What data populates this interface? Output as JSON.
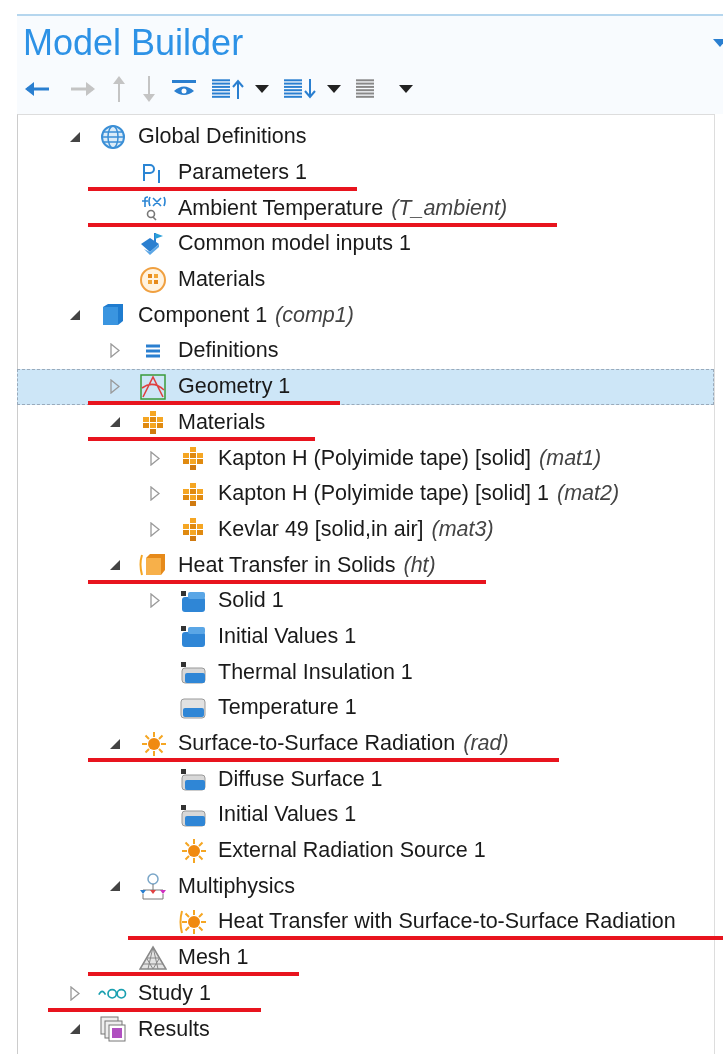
{
  "title": "Model Builder",
  "toolbar": [
    {
      "kind": "back",
      "disabled": false
    },
    {
      "kind": "forward",
      "disabled": true
    },
    {
      "kind": "up",
      "disabled": true
    },
    {
      "kind": "down",
      "disabled": true
    },
    {
      "kind": "eye",
      "disabled": false
    },
    {
      "kind": "list-up",
      "disabled": false
    },
    {
      "kind": "list-down",
      "disabled": false
    },
    {
      "kind": "list",
      "disabled": false
    }
  ],
  "tree": [
    {
      "label": "Global Definitions",
      "kind": "globe",
      "expanded": true,
      "selected": false,
      "marked": false,
      "children": [
        {
          "label": "Parameters 1",
          "kind": "param",
          "selected": false,
          "marked": true
        },
        {
          "label": "Ambient Temperature",
          "tag": "(T_ambient)",
          "kind": "function",
          "selected": false,
          "marked": true
        },
        {
          "label": "Common model inputs 1",
          "kind": "inputs",
          "selected": false,
          "marked": false
        },
        {
          "label": "Materials",
          "kind": "materials-global",
          "selected": false,
          "marked": false
        }
      ]
    },
    {
      "label": "Component 1",
      "tag": "(comp1)",
      "kind": "component",
      "expanded": true,
      "selected": false,
      "marked": false,
      "children": [
        {
          "label": "Definitions",
          "kind": "definitions",
          "expanded": false,
          "selected": false,
          "marked": false
        },
        {
          "label": "Geometry 1",
          "kind": "geometry",
          "expanded": false,
          "selected": true,
          "marked": true
        },
        {
          "label": "Materials",
          "kind": "material",
          "expanded": true,
          "selected": false,
          "marked": true,
          "children": [
            {
              "label": "Kapton H (Polyimide tape) [solid]",
              "tag": "(mat1)",
              "kind": "material",
              "expanded": false,
              "selected": false,
              "marked": false
            },
            {
              "label": "Kapton H (Polyimide tape) [solid] 1",
              "tag": "(mat2)",
              "kind": "material",
              "expanded": false,
              "selected": false,
              "marked": false
            },
            {
              "label": "Kevlar 49 [solid,in air]",
              "tag": "(mat3)",
              "kind": "material",
              "expanded": false,
              "selected": false,
              "marked": false
            }
          ]
        },
        {
          "label": "Heat Transfer in Solids",
          "tag": "(ht)",
          "kind": "heat",
          "expanded": true,
          "selected": false,
          "marked": true,
          "children": [
            {
              "label": "Solid 1",
              "kind": "domain",
              "expanded": false,
              "selected": false,
              "marked": false
            },
            {
              "label": "Initial Values 1",
              "kind": "domain",
              "selected": false,
              "marked": false
            },
            {
              "label": "Thermal Insulation 1",
              "kind": "boundary",
              "selected": false,
              "marked": false
            },
            {
              "label": "Temperature 1",
              "kind": "temperature",
              "selected": false,
              "marked": false
            }
          ]
        },
        {
          "label": "Surface-to-Surface Radiation",
          "tag": "(rad)",
          "kind": "sun",
          "expanded": true,
          "selected": false,
          "marked": true,
          "children": [
            {
              "label": "Diffuse Surface 1",
              "kind": "boundary",
              "selected": false,
              "marked": false
            },
            {
              "label": "Initial Values 1",
              "kind": "boundary",
              "selected": false,
              "marked": false
            },
            {
              "label": "External Radiation Source 1",
              "kind": "sun",
              "selected": false,
              "marked": false
            }
          ]
        },
        {
          "label": "Multiphysics",
          "kind": "multiphysics",
          "expanded": true,
          "selected": false,
          "marked": false,
          "children": [
            {
              "label": "Heat Transfer with Surface-to-Surface Radiation",
              "kind": "coupling",
              "selected": false,
              "marked": true
            }
          ]
        },
        {
          "label": "Mesh 1",
          "kind": "mesh",
          "selected": false,
          "marked": true
        }
      ]
    },
    {
      "label": "Study 1",
      "kind": "study",
      "expanded": false,
      "selected": false,
      "marked": true
    },
    {
      "label": "Results",
      "kind": "results",
      "expanded": true,
      "selected": false,
      "marked": false
    }
  ]
}
